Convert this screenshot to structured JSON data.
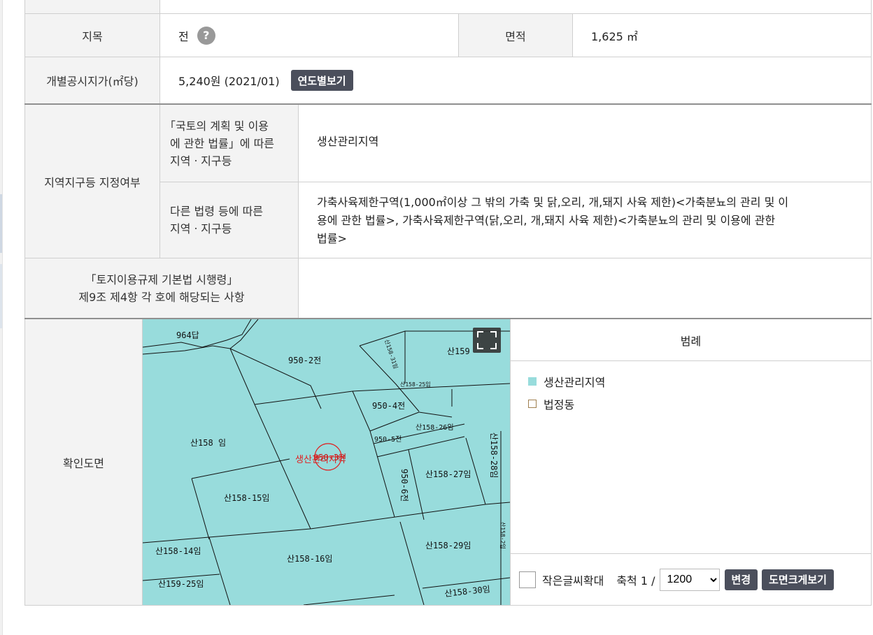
{
  "row_jimok": {
    "label": "지목",
    "value": "전",
    "help_icon": "question-icon",
    "area_label": "면적",
    "area_value": "1,625 ㎡"
  },
  "row_price": {
    "label": "개별공시지가(㎡당)",
    "value": "5,240원 (2021/01)",
    "button": "연도별보기"
  },
  "row_zone": {
    "label": "지역지구등 지정여부",
    "sub1_label": [
      "「국토의 계획 및 이용",
      "에 관한 법률」에 따른",
      "지역ㆍ지구등"
    ],
    "sub1_value": "생산관리지역",
    "sub2_label": [
      "다른 법령 등에 따른",
      "지역ㆍ지구등"
    ],
    "sub2_value": [
      "가축사육제한구역(1,000㎡이상 그 밖의 가축 및 닭,오리, 개,돼지 사육 제한)<가축분뇨의 관리 및 이",
      "용에 관한 법률>, 가축사육제한구역(닭,오리, 개,돼지 사육 제한)<가축분뇨의 관리 및 이용에 관한",
      "법률>"
    ]
  },
  "row_reg": {
    "label": [
      "「토지이용규제 기본법 시행령」",
      "제9조 제4항 각 호에 해당되는 사항"
    ],
    "value": ""
  },
  "row_map": {
    "label": "확인도면"
  },
  "map": {
    "fill": "#98dcdc",
    "parcel_labels": [
      "964답",
      "950-2전",
      "산159",
      "950-4전",
      "950-5전",
      "산158-26임",
      "산158 임",
      "생산관리지역",
      "950-3전",
      "산158-27임",
      "산158-28임",
      "950-6전",
      "산158-15임",
      "산158-14임",
      "산158-16임",
      "산158-29임",
      "산159-25임",
      "산158-30임",
      "산158-25임",
      "산158-31임",
      "산158-2임"
    ],
    "expand_icon": "fullscreen-icon"
  },
  "legend": {
    "title": "범례",
    "items": [
      {
        "label": "생산관리지역",
        "color": "#98dcdc",
        "type": "filled"
      },
      {
        "label": "법정동",
        "color": "#a08050",
        "type": "outline"
      }
    ]
  },
  "controls": {
    "enlarge_text_label": "작은글씨확대",
    "scale_label": "축척 1 /",
    "scale_value": "1200",
    "change_button": "변경",
    "big_map_button": "도면크게보기"
  }
}
